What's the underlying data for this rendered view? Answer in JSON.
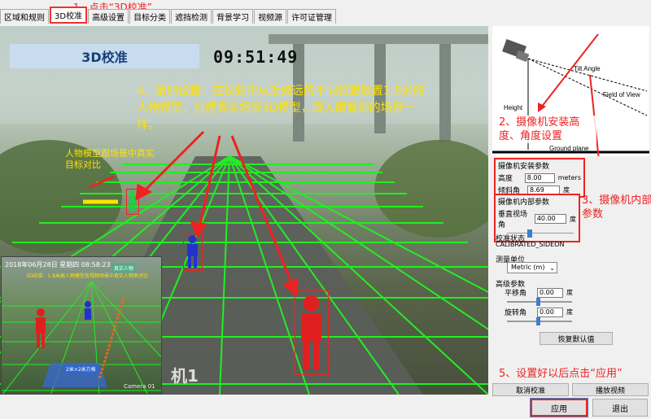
{
  "tabs": [
    "区域和规则",
    "3D校准",
    "高级设置",
    "目标分类",
    "遮挡检测",
    "背景学习",
    "视频源",
    "许可证管理"
  ],
  "active_tab": "3D校准",
  "notes": {
    "step1": "1、点击“3D校准”",
    "step2": "2、摄像机安装高度、角度设置",
    "step3": "3、摄像机内部参数",
    "step4": "4、第四设置：在视频中从近到远的不同位置放置1.8米的人物模型，创建真实场景3D模型，跟人眼看到的场景一样。",
    "step5": "5、设置好以后点击“应用”",
    "compare": "人物模型跟场景中真实目标对比"
  },
  "video": {
    "title": "3D校准",
    "clock": "09:51:49",
    "camera_label": "机1",
    "inset": {
      "timestamp": "2018年06月28日 星期四 08:58:23",
      "caption": "3D校准：1.8米高人物模型放视频场景中真实人物来对比",
      "tag": "真实人物",
      "size_label": "2米×2米方格",
      "camera": "Camera 01"
    }
  },
  "diagram": {
    "tilt": "Tilt Angle",
    "fov": "Field of View",
    "height": "Height",
    "ground": "Ground plane"
  },
  "install": {
    "title": "摄像机安装参数",
    "height_label": "高度",
    "height_value": "8.00",
    "height_unit": "meters",
    "tilt_label": "倾斜角",
    "tilt_value": "8.69",
    "tilt_unit": "度"
  },
  "internal": {
    "title": "摄像机内部参数",
    "vfov_label": "垂直视场角",
    "vfov_value": "40.00",
    "vfov_unit": "度",
    "vfov_level": 0.3
  },
  "status": {
    "label": "校准状态",
    "value": "CALIBRATED_SIDEON"
  },
  "units": {
    "label": "测量单位",
    "value": "Metric (m)"
  },
  "advanced": {
    "label": "高级参数",
    "pan_label": "平移角",
    "pan_value": "0.00",
    "pan_unit": "度",
    "rot_label": "旋转角",
    "rot_value": "0.00",
    "rot_unit": "度"
  },
  "buttons": {
    "restore": "恢复默认值",
    "cancel_calib": "取消校准",
    "play": "播放视频",
    "apply": "应用",
    "exit": "退出"
  },
  "colors": {
    "accent": "#e22222",
    "grid": "#22ee22",
    "annotation": "#ffe100",
    "model": "#e02020",
    "model2": "#2233cc"
  }
}
